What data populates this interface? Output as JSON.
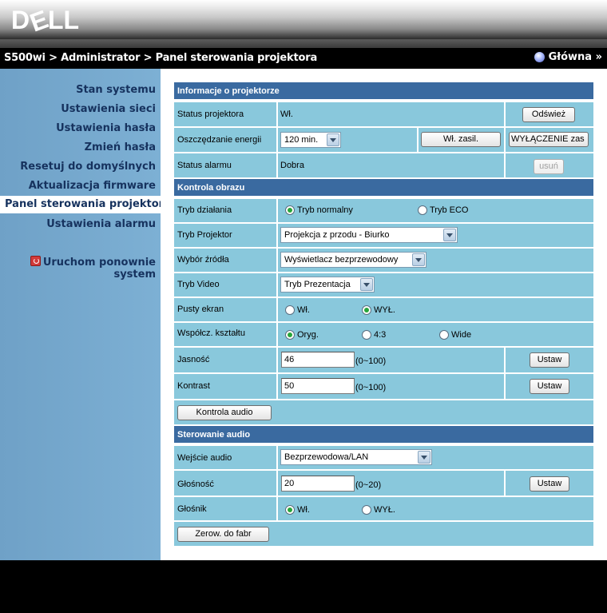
{
  "header": {
    "logo_text": "DELL",
    "logo_icon": "dell-logo"
  },
  "breadcrumb": {
    "text": "S500wi > Administrator > Panel sterowania projektora",
    "home_label": "Główna »",
    "home_icon": "globe-icon"
  },
  "sidebar": {
    "items": [
      {
        "label": "Stan systemu"
      },
      {
        "label": "Ustawienia sieci"
      },
      {
        "label": "Ustawienia hasła"
      },
      {
        "label": "Zmień hasła"
      },
      {
        "label": "Resetuj do domyślnych"
      },
      {
        "label": "Aktualizacja firmware"
      },
      {
        "label": "Panel sterowania projektora",
        "active": true
      },
      {
        "label": "Ustawienia alarmu"
      }
    ],
    "reboot_label_1": "Uruchom ponownie",
    "reboot_label_2": "system",
    "reboot_icon": "power-icon"
  },
  "info": {
    "title": "Informacje o projektorze",
    "status_label": "Status projektora",
    "status_value": "Wł.",
    "refresh_button": "Odśwież",
    "power_saving_label": "Oszczędzanie energii",
    "power_saving_value": "120 min.",
    "power_on_button": "Wł. zasil.",
    "power_off_button": "WYŁĄCZENIE zas",
    "alarm_label": "Status alarmu",
    "alarm_value": "Dobra",
    "clear_button": "usuń"
  },
  "image": {
    "title": "Kontrola obrazu",
    "mode_label": "Tryb działania",
    "mode_normal": "Tryb normalny",
    "mode_eco": "Tryb ECO",
    "mode_selected": "normal",
    "projector_mode_label": "Tryb Projektor",
    "projector_mode_value": "Projekcja z przodu - Biurko",
    "source_label": "Wybór źródła",
    "source_value": "Wyświetlacz bezprzewodowy",
    "video_mode_label": "Tryb Video",
    "video_mode_value": "Tryb Prezentacja",
    "blank_label": "Pusty ekran",
    "blank_on": "Wł.",
    "blank_off": "WYŁ.",
    "blank_selected": "off",
    "aspect_label": "Współcz. kształtu",
    "aspect_orig": "Oryg.",
    "aspect_43": "4:3",
    "aspect_wide": "Wide",
    "aspect_selected": "orig",
    "brightness_label": "Jasność",
    "brightness_value": "46",
    "brightness_range": "(0~100)",
    "contrast_label": "Kontrast",
    "contrast_value": "50",
    "contrast_range": "(0~100)",
    "set_button": "Ustaw",
    "audio_control_button": "Kontrola audio"
  },
  "audio": {
    "title": "Sterowanie audio",
    "input_label": "Wejście audio",
    "input_value": "Bezprzewodowa/LAN",
    "volume_label": "Głośność",
    "volume_value": "20",
    "volume_range": "(0~20)",
    "speaker_label": "Głośnik",
    "speaker_on": "Wł.",
    "speaker_off": "WYŁ.",
    "speaker_selected": "on",
    "set_button": "Ustaw",
    "reset_button": "Zerow. do fabr"
  }
}
